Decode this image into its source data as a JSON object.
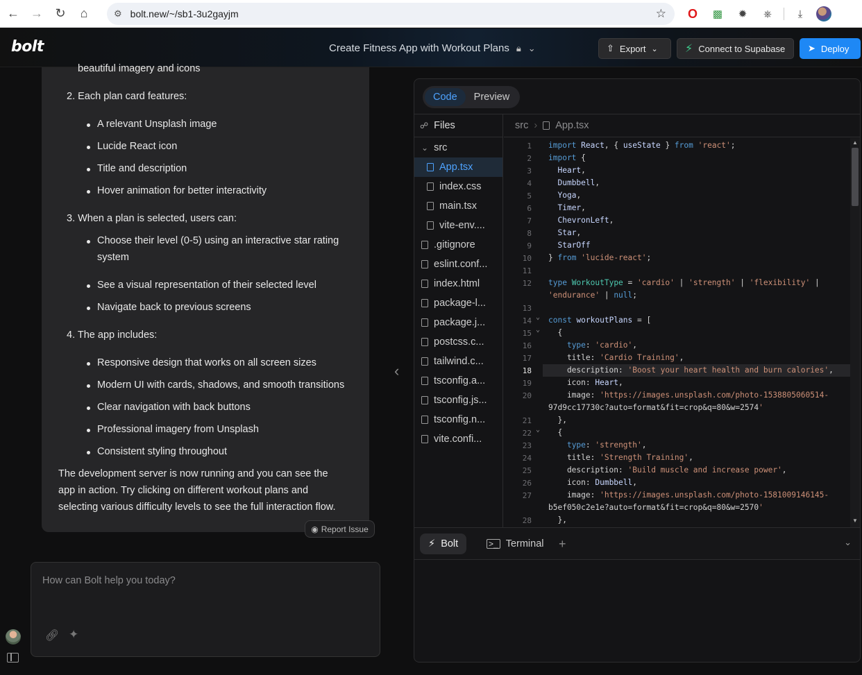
{
  "browser": {
    "url": "bolt.new/~/sb1-3u2gayjm",
    "back_icon": "arrow-left-icon",
    "forward_icon": "arrow-right-icon",
    "reload_icon": "reload-icon",
    "home_icon": "home-icon"
  },
  "header": {
    "logo": "bolt",
    "project_title": "Create Fitness App with Workout Plans",
    "export_label": "Export",
    "supabase_label": "Connect to Supabase",
    "deploy_label": "Deploy"
  },
  "chat": {
    "cut_line": "beautiful imagery and icons",
    "items": [
      {
        "n": "2. Each plan card features:"
      },
      {
        "b": "A relevant Unsplash image"
      },
      {
        "b": "Lucide React icon"
      },
      {
        "b": "Title and description"
      },
      {
        "b": "Hover animation for better interactivity"
      },
      {
        "n": "3. When a plan is selected, users can:"
      },
      {
        "b": "Choose their level (0-5) using an interactive star rating"
      },
      {
        "b2": "system"
      },
      {
        "b": "See a visual representation of their selected level"
      },
      {
        "b": "Navigate back to previous screens"
      },
      {
        "n": "4. The app includes:"
      },
      {
        "b": "Responsive design that works on all screen sizes"
      },
      {
        "b": "Modern UI with cards, shadows, and smooth transitions"
      },
      {
        "b": "Clear navigation with back buttons"
      },
      {
        "b": "Professional imagery from Unsplash"
      },
      {
        "b": "Consistent styling throughout"
      }
    ],
    "closing": [
      "The development server is now running and you can see the",
      "app in action. Try clicking on different workout plans and",
      "selecting various difficulty levels to see the full interaction flow."
    ],
    "report_label": "Report Issue",
    "prompt_placeholder": "How can Bolt help you today?"
  },
  "workbench": {
    "tabs": [
      "Code",
      "Preview"
    ],
    "active_tab": "Code",
    "files_label": "Files",
    "tree": [
      {
        "name": "src",
        "type": "folder"
      },
      {
        "name": "App.tsx",
        "type": "file",
        "active": true
      },
      {
        "name": "index.css",
        "type": "file"
      },
      {
        "name": "main.tsx",
        "type": "file"
      },
      {
        "name": "vite-env....",
        "type": "file"
      },
      {
        "name": ".gitignore",
        "type": "file"
      },
      {
        "name": "eslint.conf...",
        "type": "file"
      },
      {
        "name": "index.html",
        "type": "file"
      },
      {
        "name": "package-l...",
        "type": "file"
      },
      {
        "name": "package.j...",
        "type": "file"
      },
      {
        "name": "postcss.c...",
        "type": "file"
      },
      {
        "name": "tailwind.c...",
        "type": "file"
      },
      {
        "name": "tsconfig.a...",
        "type": "file"
      },
      {
        "name": "tsconfig.js...",
        "type": "file"
      },
      {
        "name": "tsconfig.n...",
        "type": "file"
      },
      {
        "name": "vite.confi...",
        "type": "file"
      }
    ],
    "path": [
      "src",
      "App.tsx"
    ],
    "current_line": 18,
    "code_lines": [
      {
        "n": "1",
        "t": "import React, { useState } from 'react';"
      },
      {
        "n": "2",
        "t": "import {"
      },
      {
        "n": "3",
        "t": "  Heart,"
      },
      {
        "n": "4",
        "t": "  Dumbbell,"
      },
      {
        "n": "5",
        "t": "  Yoga,"
      },
      {
        "n": "6",
        "t": "  Timer,"
      },
      {
        "n": "7",
        "t": "  ChevronLeft,"
      },
      {
        "n": "8",
        "t": "  Star,"
      },
      {
        "n": "9",
        "t": "  StarOff"
      },
      {
        "n": "10",
        "t": "} from 'lucide-react';"
      },
      {
        "n": "11",
        "t": ""
      },
      {
        "n": "12",
        "t": "type WorkoutType = 'cardio' | 'strength' | 'flexibility' |"
      },
      {
        "n": "",
        "t": "'endurance' | null;"
      },
      {
        "n": "13",
        "t": ""
      },
      {
        "n": "14",
        "t": "const workoutPlans = ["
      },
      {
        "n": "15",
        "t": "  {"
      },
      {
        "n": "16",
        "t": "    type: 'cardio',"
      },
      {
        "n": "17",
        "t": "    title: 'Cardio Training',"
      },
      {
        "n": "18",
        "t": "    description: 'Boost your heart health and burn calories',"
      },
      {
        "n": "19",
        "t": "    icon: Heart,"
      },
      {
        "n": "20",
        "t": "    image: 'https://images.unsplash.com/photo-1538805060514-"
      },
      {
        "n": "",
        "t": "97d9cc17730c?auto=format&fit=crop&q=80&w=2574'"
      },
      {
        "n": "21",
        "t": "  },"
      },
      {
        "n": "22",
        "t": "  {"
      },
      {
        "n": "23",
        "t": "    type: 'strength',"
      },
      {
        "n": "24",
        "t": "    title: 'Strength Training',"
      },
      {
        "n": "25",
        "t": "    description: 'Build muscle and increase power',"
      },
      {
        "n": "26",
        "t": "    icon: Dumbbell,"
      },
      {
        "n": "27",
        "t": "    image: 'https://images.unsplash.com/photo-1581009146145-"
      },
      {
        "n": "",
        "t": "b5ef050c2e1e?auto=format&fit=crop&q=80&w=2570'"
      },
      {
        "n": "28",
        "t": "  },"
      }
    ],
    "bottom_tabs": {
      "bolt": "Bolt",
      "terminal": "Terminal",
      "plus": "+"
    }
  },
  "colors": {
    "accent": "#1e88f5",
    "supabase": "#3ecf8e",
    "active_file": "#4ea3ff"
  }
}
